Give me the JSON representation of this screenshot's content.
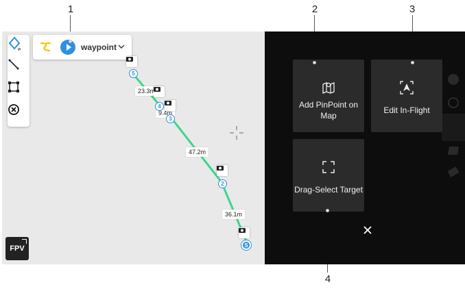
{
  "callouts": [
    "1",
    "2",
    "3",
    "4"
  ],
  "waypoint_panel": {
    "mode_label": "waypoint",
    "icons": [
      "route-icon",
      "play-icon",
      "chevron-down-icon"
    ]
  },
  "map_tools": [
    "waypoint-tool-icon",
    "line-tool-icon",
    "area-tool-icon",
    "clear-icon"
  ],
  "fpv_label": "FPV",
  "distances": [
    "23.3m",
    "9.4m",
    "47.2m",
    "36.1m"
  ],
  "waypoints": [
    "5",
    "4",
    "3",
    "2",
    "S"
  ],
  "panel": {
    "add_pinpoint": "Add PinPoint on Map",
    "edit_inflight": "Edit In-Flight",
    "drag_select": "Drag-Select Target"
  },
  "colors": {
    "route": "#3cd68e",
    "waypoint": "#2f8fe0",
    "panel_bg": "#0d0d0d",
    "tile_bg": "#2b2b2b"
  }
}
